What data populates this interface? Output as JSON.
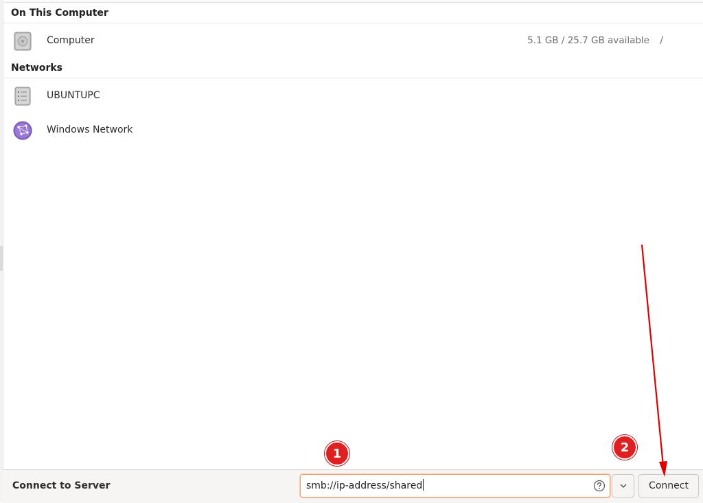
{
  "sections": {
    "on_this_computer": "On This Computer",
    "networks": "Networks"
  },
  "computer": {
    "label": "Computer",
    "usage": "5.1 GB / 25.7 GB available",
    "mount": "/",
    "icon": "drive-harddisk-icon"
  },
  "network_items": [
    {
      "label": "UBUNTUPC",
      "icon": "network-server-icon"
    },
    {
      "label": "Windows Network",
      "icon": "network-workgroup-icon"
    }
  ],
  "connect_bar": {
    "label": "Connect to Server",
    "address_value": "smb://ip-address/shared",
    "connect_label": "Connect"
  },
  "annotations": {
    "step1": "1",
    "step2": "2",
    "badge_color": "#e02020",
    "arrow_color": "#e00000"
  },
  "colors": {
    "focus_border": "#f0a070",
    "network_icon": "#8a63c9"
  }
}
